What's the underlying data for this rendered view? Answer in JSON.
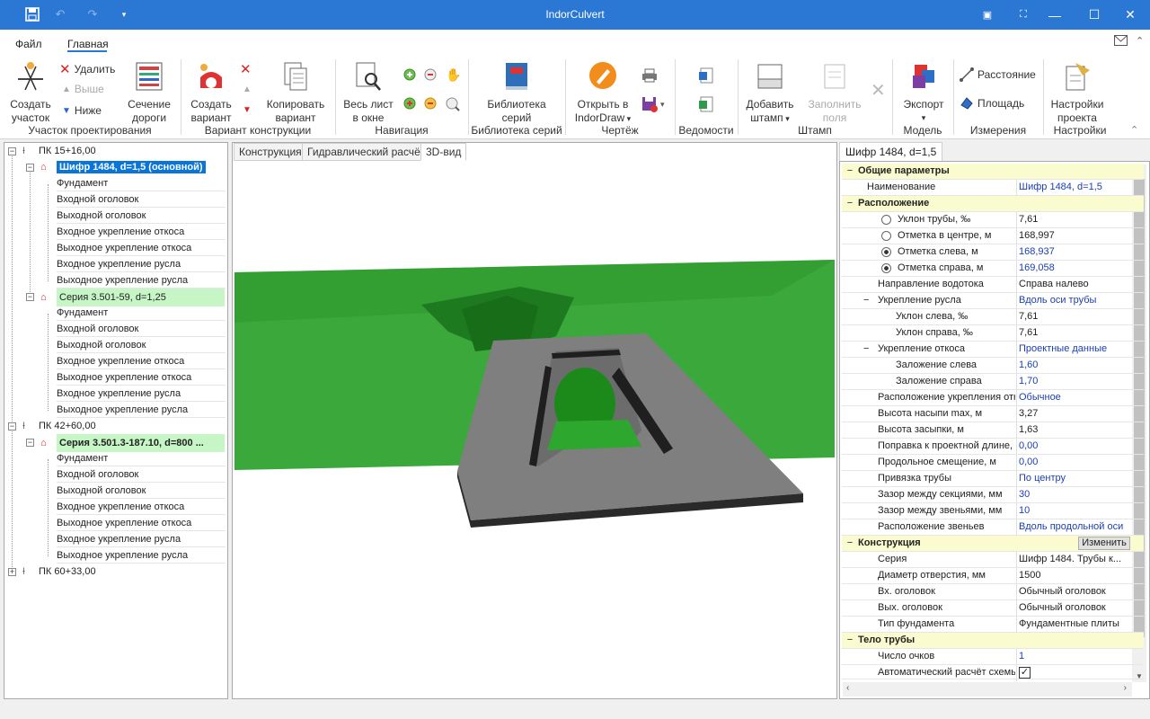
{
  "window": {
    "title": "IndorCulvert"
  },
  "menu": {
    "file": "Файл",
    "home": "Главная"
  },
  "ribbon": {
    "create_section": "Создать участок",
    "delete": "Удалить",
    "up": "Выше",
    "down": "Ниже",
    "road_section": "Сечение дороги",
    "create_variant": "Создать вариант",
    "copy_variant": "Копировать вариант",
    "whole_sheet": "Весь лист в окне",
    "series_library": "Библиотека серий",
    "open_indordraw": "Открыть в IndorDraw",
    "add_stamp": "Добавить штамп",
    "fill_fields": "Заполнить поля",
    "export": "Экспорт",
    "distance": "Расстояние",
    "area": "Площадь",
    "project_settings": "Настройки проекта",
    "groups": {
      "design_section": "Участок проектирования",
      "construction_variant": "Вариант конструкции",
      "navigation": "Навигация",
      "series_library": "Библиотека серий",
      "drawing": "Чертёж",
      "statements": "Ведомости",
      "stamp": "Штамп",
      "model": "Модель",
      "measurements": "Измерения",
      "settings": "Настройки"
    }
  },
  "tree": {
    "pk1": "ПК 15+16,00",
    "v1": "Шифр 1484, d=1,5 (основной)",
    "v1_children": [
      "Фундамент",
      "Входной оголовок",
      "Выходной оголовок",
      "Входное укрепление откоса",
      "Выходное укрепление откоса",
      "Входное укрепление русла",
      "Выходное укрепление русла"
    ],
    "v2": "Серия 3.501-59, d=1,25",
    "v2_children": [
      "Фундамент",
      "Входной оголовок",
      "Выходной оголовок",
      "Входное укрепление откоса",
      "Выходное укрепление откоса",
      "Входное укрепление русла",
      "Выходное укрепление русла"
    ],
    "pk2": "ПК 42+60,00",
    "v3": "Серия 3.501.3-187.10, d=800 ...",
    "v3_children": [
      "Фундамент",
      "Входной оголовок",
      "Выходной оголовок",
      "Входное укрепление откоса",
      "Выходное укрепление откоса",
      "Входное укрепление русла",
      "Выходное укрепление русла"
    ],
    "pk3": "ПК 60+33,00"
  },
  "center_tabs": [
    "Конструкция",
    "Гидравлический расчёт",
    "3D-вид"
  ],
  "right_tab": "Шифр 1484, d=1,5",
  "props": {
    "cat1": "Общие параметры",
    "name_l": "Наименование",
    "name_v": "Шифр 1484, d=1,5",
    "cat2": "Расположение",
    "slope_l": "Уклон трубы, ‰",
    "slope_v": "7,61",
    "mark_center_l": "Отметка в центре, м",
    "mark_center_v": "168,997",
    "mark_left_l": "Отметка слева, м",
    "mark_left_v": "168,937",
    "mark_right_l": "Отметка справа, м",
    "mark_right_v": "169,058",
    "flow_dir_l": "Направление водотока",
    "flow_dir_v": "Справа налево",
    "bed_l": "Укрепление русла",
    "bed_v": "Вдоль оси трубы",
    "bed_left_l": "Уклон слева, ‰",
    "bed_left_v": "7,61",
    "bed_right_l": "Уклон справа, ‰",
    "bed_right_v": "7,61",
    "slope_str_l": "Укрепление откоса",
    "slope_str_v": "Проектные данные",
    "lay_left_l": "Заложение слева",
    "lay_left_v": "1,60",
    "lay_right_l": "Заложение справа",
    "lay_right_v": "1,70",
    "str_pos_l": "Расположение укрепления отк",
    "str_pos_v": "Обычное",
    "emb_l": "Высота насыпи max, м",
    "emb_v": "3,27",
    "fill_l": "Высота засыпки, м",
    "fill_v": "1,63",
    "corr_l": "Поправка к проектной длине,",
    "corr_v": "0,00",
    "shift_l": "Продольное смещение, м",
    "shift_v": "0,00",
    "bind_l": "Привязка трубы",
    "bind_v": "По центру",
    "gap_sec_l": "Зазор между секциями, мм",
    "gap_sec_v": "30",
    "gap_link_l": "Зазор между звеньями, мм",
    "gap_link_v": "10",
    "link_pos_l": "Расположение звеньев",
    "link_pos_v": "Вдоль продольной оси",
    "cat3": "Конструкция",
    "change_btn": "Изменить",
    "series_l": "Серия",
    "series_v": "Шифр 1484. Трубы к...",
    "diam_l": "Диаметр отверстия, мм",
    "diam_v": "1500",
    "in_head_l": "Вх. оголовок",
    "in_head_v": "Обычный оголовок",
    "out_head_l": "Вых. оголовок",
    "out_head_v": "Обычный оголовок",
    "found_l": "Тип фундамента",
    "found_v": "Фундаментные плиты",
    "cat4": "Тело трубы",
    "holes_l": "Число очков",
    "holes_v": "1",
    "auto_l": "Автоматический расчёт схемы"
  }
}
